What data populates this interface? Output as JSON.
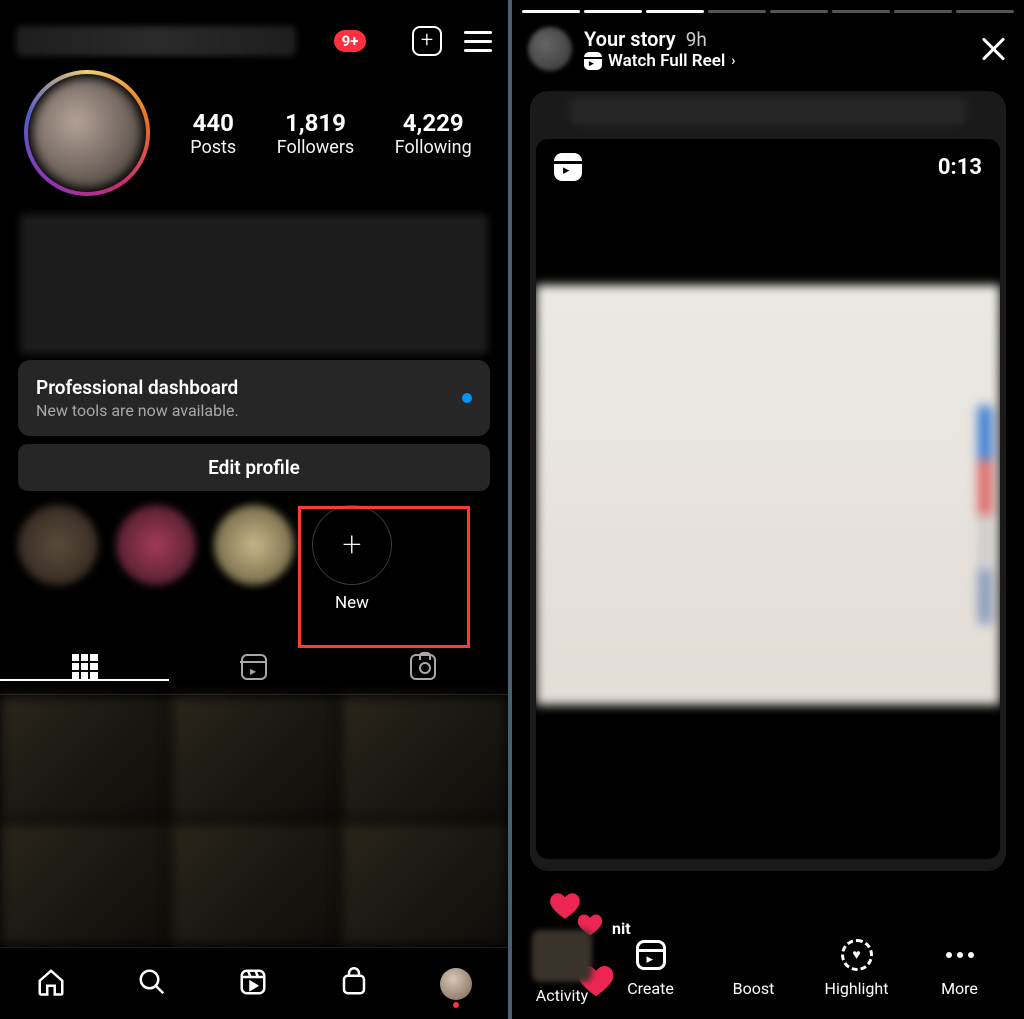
{
  "left": {
    "notif_badge": "9+",
    "stats": {
      "posts_num": "440",
      "posts_label": "Posts",
      "followers_num": "1,819",
      "followers_label": "Followers",
      "following_num": "4,229",
      "following_label": "Following"
    },
    "dashboard": {
      "title": "Professional dashboard",
      "subtitle": "New tools are now available."
    },
    "edit_profile": "Edit profile",
    "highlight_new": "New"
  },
  "right": {
    "title": "Your story",
    "time": "9h",
    "watch_reel": "Watch Full Reel",
    "reel_time": "0:13",
    "heart_label": "nit",
    "bottom": {
      "activity": "Activity",
      "create": "Create",
      "boost": "Boost",
      "highlight": "Highlight",
      "more": "More"
    }
  }
}
